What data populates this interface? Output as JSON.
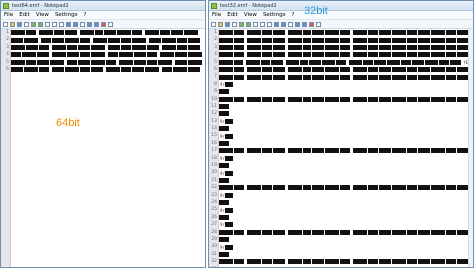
{
  "left_window": {
    "title": "test64.emf - Notepad2",
    "menu": [
      "File",
      "Edit",
      "View",
      "Settings",
      "?"
    ],
    "line_numbers": [
      "1",
      "2",
      "3",
      "4",
      "5",
      "6"
    ],
    "overlay_label": "64bit"
  },
  "right_window": {
    "title": "test32.emf - Notepad2",
    "menu": [
      "File",
      "Edit",
      "View",
      "Settings",
      "?"
    ],
    "line_numbers": [
      "1",
      "2",
      "3",
      "4",
      "5",
      "6",
      "7",
      "8",
      "9",
      "10",
      "11",
      "12",
      "13",
      "14",
      "15",
      "16",
      "17",
      "18",
      "19",
      "20",
      "21",
      "22",
      "23",
      "24",
      "25",
      "26",
      "27",
      "28",
      "29",
      "30",
      "31",
      "32",
      "33",
      "34"
    ],
    "overlay_label": "32bit",
    "visible_text": {
      "l5": "†EVL",
      "l8": "9r",
      "l13": "9r",
      "l15": "9r",
      "l18": "9r",
      "l20": "9r",
      "l23": "9r",
      "l25": "9r",
      "l27": "9r",
      "l30": "9r",
      "l33": "9r"
    }
  }
}
